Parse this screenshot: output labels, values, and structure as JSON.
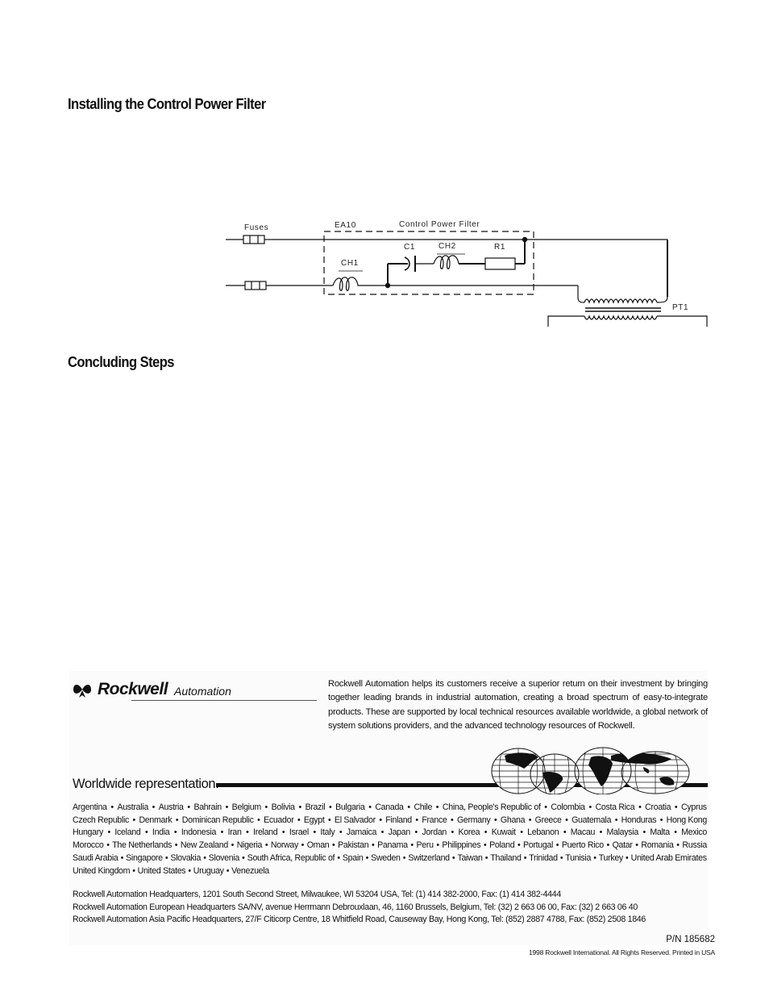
{
  "sections": {
    "install_heading": "Installing the Control Power Filter",
    "concluding_heading": "Concluding Steps"
  },
  "diagram": {
    "labels": {
      "fuses": "Fuses",
      "ea10": "EA10",
      "filter": "Control Power Filter",
      "c1": "C1",
      "ch2": "CH2",
      "r1": "R1",
      "ch1": "CH1",
      "pt1": "PT1"
    }
  },
  "footer": {
    "logo": {
      "brand": "Rockwell",
      "sub": "Automation"
    },
    "blurb": "Rockwell Automation helps its customers receive a superior return on their investment by bringing together leading brands in industrial automation, creating a broad spectrum of easy-to-integrate products.  These are supported by local technical resources available worldwide, a global network of system solutions providers, and the advanced technology resources of Rockwell.",
    "worldwide_title": "Worldwide representation.",
    "country_rows": [
      [
        "Argentina",
        "Australia",
        "Austria",
        "Bahrain",
        "Belgium",
        "Bolivia",
        "Brazil",
        "Bulgaria",
        "Canada",
        "Chile",
        "China, People's Republic of",
        "Colombia",
        "Costa Rica",
        "Croatia",
        "Cyprus"
      ],
      [
        "Czech Republic",
        "Denmark",
        "Dominican Republic",
        "Ecuador",
        "Egypt",
        "El Salvador",
        "Finland",
        "France",
        "Germany",
        "Ghana",
        "Greece",
        "Guatemala",
        "Honduras",
        "Hong Kong"
      ],
      [
        "Hungary",
        "Iceland",
        "India",
        "Indonesia",
        "Iran",
        "Ireland",
        "Israel",
        "Italy",
        "Jamaica",
        "Japan",
        "Jordan",
        "Korea",
        "Kuwait",
        "Lebanon",
        "Macau",
        "Malaysia",
        "Malta",
        "Mexico"
      ],
      [
        "Morocco",
        "The Netherlands",
        "New Zealand",
        "Nigeria",
        "Norway",
        "Oman",
        "Pakistan",
        "Panama",
        "Peru",
        "Philippines",
        "Poland",
        "Portugal",
        "Puerto Rico",
        "Qatar",
        "Romania",
        "Russia"
      ],
      [
        "Saudi Arabia",
        "Singapore",
        "Slovakia",
        "Slovenia",
        "South Africa, Republic of",
        "Spain",
        "Sweden",
        "Switzerland",
        "Taiwan",
        "Thailand",
        "Trinidad",
        "Tunisia",
        "Turkey",
        "United Arab Emirates"
      ],
      [
        "United Kingdom",
        "United States",
        "Uruguay",
        "Venezuela"
      ]
    ],
    "addresses": [
      "Rockwell Automation Headquarters, 1201 South Second Street, Milwaukee, WI 53204 USA, Tel: (1) 414 382-2000, Fax: (1) 414 382-4444",
      "Rockwell Automation European Headquarters SA/NV, avenue Herrmann Debrouxlaan, 46, 1160 Brussels, Belgium, Tel: (32) 2 663 06 00, Fax: (32) 2 663 06 40",
      "Rockwell Automation Asia Pacific Headquarters, 27/F Citicorp Centre, 18 Whitfield Road, Causeway Bay, Hong Kong, Tel: (852) 2887 4788, Fax: (852) 2508 1846"
    ],
    "part_number": "P/N 185682",
    "copyright": "1998 Rockwell International. All Rights Reserved. Printed in USA"
  }
}
